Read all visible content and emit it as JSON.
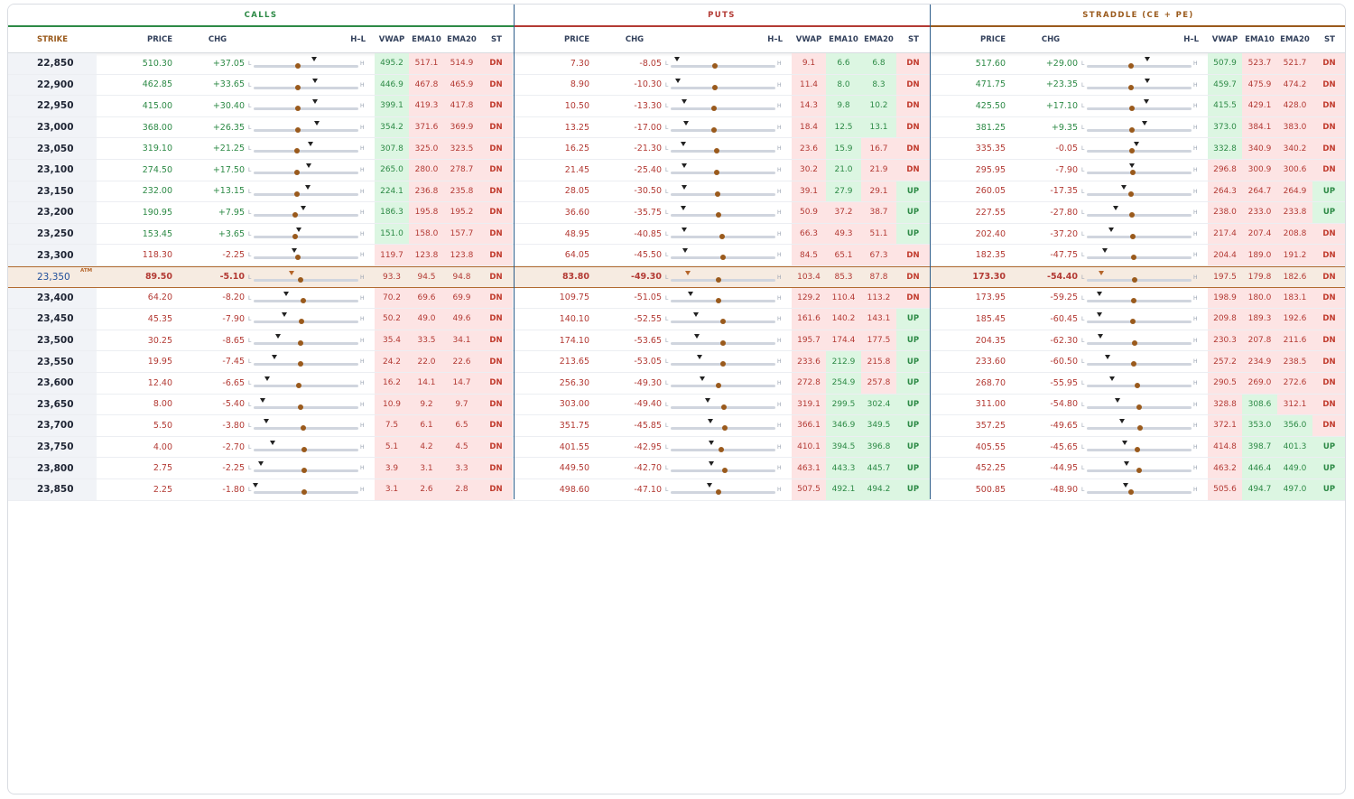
{
  "headers": {
    "calls": "CALLS",
    "puts": "PUTS",
    "straddle": "STRADDLE (CE + PE)",
    "strike": "STRIKE",
    "price": "PRICE",
    "chg": "CHG",
    "hl": "H–L",
    "vwap": "VWAP",
    "ema10": "EMA10",
    "ema20": "EMA20",
    "st": "ST",
    "low_label": "L",
    "high_label": "H",
    "atm_tag": "ATM"
  },
  "colors": {
    "calls": "#2d8a46",
    "puts": "#b33a34",
    "straddle": "#9a5a1c",
    "red_text": "#b33a34",
    "green_text": "#2d8a46",
    "red_bg": "#fde4e4",
    "green_bg": "#dcf6e2",
    "atm_bg": "#f6ebe1"
  },
  "icons": {
    "range_marker": "triangle-down-icon",
    "ltp_dot": "dot-icon"
  },
  "atm_strike": "23,350",
  "rows": [
    {
      "strike": "22,850",
      "c": [
        "510.30",
        "+37.05",
        0.58,
        0.42,
        "495.2",
        "517.1",
        "514.9",
        "DN"
      ],
      "p": [
        "7.30",
        "-8.05",
        0.06,
        0.42,
        "9.1",
        "6.6",
        "6.8",
        "DN"
      ],
      "s": [
        "517.60",
        "+29.00",
        0.58,
        0.42,
        "507.9",
        "523.7",
        "521.7",
        "DN"
      ]
    },
    {
      "strike": "22,900",
      "c": [
        "462.85",
        "+33.65",
        0.59,
        0.42,
        "446.9",
        "467.8",
        "465.9",
        "DN"
      ],
      "p": [
        "8.90",
        "-10.30",
        0.07,
        0.42,
        "11.4",
        "8.0",
        "8.3",
        "DN"
      ],
      "s": [
        "471.75",
        "+23.35",
        0.58,
        0.42,
        "459.7",
        "475.9",
        "474.2",
        "DN"
      ]
    },
    {
      "strike": "22,950",
      "c": [
        "415.00",
        "+30.40",
        0.59,
        0.42,
        "399.1",
        "419.3",
        "417.8",
        "DN"
      ],
      "p": [
        "10.50",
        "-13.30",
        0.13,
        0.41,
        "14.3",
        "9.8",
        "10.2",
        "DN"
      ],
      "s": [
        "425.50",
        "+17.10",
        0.57,
        0.43,
        "415.5",
        "429.1",
        "428.0",
        "DN"
      ]
    },
    {
      "strike": "23,000",
      "c": [
        "368.00",
        "+26.35",
        0.6,
        0.42,
        "354.2",
        "371.6",
        "369.9",
        "DN"
      ],
      "p": [
        "13.25",
        "-17.00",
        0.15,
        0.41,
        "18.4",
        "12.5",
        "13.1",
        "DN"
      ],
      "s": [
        "381.25",
        "+9.35",
        0.55,
        0.43,
        "373.0",
        "384.1",
        "383.0",
        "DN"
      ]
    },
    {
      "strike": "23,050",
      "c": [
        "319.10",
        "+21.25",
        0.54,
        0.41,
        "307.8",
        "325.0",
        "323.5",
        "DN"
      ],
      "p": [
        "16.25",
        "-21.30",
        0.12,
        0.44,
        "23.6",
        "15.9",
        "16.7",
        "DN"
      ],
      "s": [
        "335.35",
        "-0.05",
        0.47,
        0.43,
        "332.8",
        "340.9",
        "340.2",
        "DN"
      ]
    },
    {
      "strike": "23,100",
      "c": [
        "274.50",
        "+17.50",
        0.53,
        0.41,
        "265.0",
        "280.0",
        "278.7",
        "DN"
      ],
      "p": [
        "21.45",
        "-25.40",
        0.13,
        0.44,
        "30.2",
        "21.0",
        "21.9",
        "DN"
      ],
      "s": [
        "295.95",
        "-7.90",
        0.43,
        0.44,
        "296.8",
        "300.9",
        "300.6",
        "DN"
      ]
    },
    {
      "strike": "23,150",
      "c": [
        "232.00",
        "+13.15",
        0.52,
        0.41,
        "224.1",
        "236.8",
        "235.8",
        "DN"
      ],
      "p": [
        "28.05",
        "-30.50",
        0.13,
        0.45,
        "39.1",
        "27.9",
        "29.1",
        "UP"
      ],
      "s": [
        "260.05",
        "-17.35",
        0.35,
        0.42,
        "264.3",
        "264.7",
        "264.9",
        "UP"
      ]
    },
    {
      "strike": "23,200",
      "c": [
        "190.95",
        "+7.95",
        0.47,
        0.4,
        "186.3",
        "195.8",
        "195.2",
        "DN"
      ],
      "p": [
        "36.60",
        "-35.75",
        0.12,
        0.46,
        "50.9",
        "37.2",
        "38.7",
        "UP"
      ],
      "s": [
        "227.55",
        "-27.80",
        0.28,
        0.43,
        "238.0",
        "233.0",
        "233.8",
        "UP"
      ]
    },
    {
      "strike": "23,250",
      "c": [
        "153.45",
        "+3.65",
        0.43,
        0.4,
        "151.0",
        "158.0",
        "157.7",
        "DN"
      ],
      "p": [
        "48.95",
        "-40.85",
        0.13,
        0.49,
        "66.3",
        "49.3",
        "51.1",
        "UP"
      ],
      "s": [
        "202.40",
        "-37.20",
        0.23,
        0.44,
        "217.4",
        "207.4",
        "208.8",
        "DN"
      ]
    },
    {
      "strike": "23,300",
      "c": [
        "118.30",
        "-2.25",
        0.39,
        0.42,
        "119.7",
        "123.8",
        "123.8",
        "DN"
      ],
      "p": [
        "64.05",
        "-45.50",
        0.14,
        0.5,
        "84.5",
        "65.1",
        "67.3",
        "DN"
      ],
      "s": [
        "182.35",
        "-47.75",
        0.17,
        0.45,
        "204.4",
        "189.0",
        "191.2",
        "DN"
      ]
    },
    {
      "strike": "23,350",
      "c": [
        "89.50",
        "-5.10",
        0.36,
        0.45,
        "93.3",
        "94.5",
        "94.8",
        "DN"
      ],
      "p": [
        "83.80",
        "-49.30",
        0.16,
        0.46,
        "103.4",
        "85.3",
        "87.8",
        "DN"
      ],
      "s": [
        "173.30",
        "-54.40",
        0.14,
        0.46,
        "197.5",
        "179.8",
        "182.6",
        "DN"
      ]
    },
    {
      "strike": "23,400",
      "c": [
        "64.20",
        "-8.20",
        0.31,
        0.47,
        "70.2",
        "69.6",
        "69.9",
        "DN"
      ],
      "p": [
        "109.75",
        "-51.05",
        0.19,
        0.46,
        "129.2",
        "110.4",
        "113.2",
        "DN"
      ],
      "s": [
        "173.95",
        "-59.25",
        0.12,
        0.45,
        "198.9",
        "180.0",
        "183.1",
        "DN"
      ]
    },
    {
      "strike": "23,450",
      "c": [
        "45.35",
        "-7.90",
        0.29,
        0.46,
        "50.2",
        "49.0",
        "49.6",
        "DN"
      ],
      "p": [
        "140.10",
        "-52.55",
        0.24,
        0.5,
        "161.6",
        "140.2",
        "143.1",
        "UP"
      ],
      "s": [
        "185.45",
        "-60.45",
        0.12,
        0.44,
        "209.8",
        "189.3",
        "192.6",
        "DN"
      ]
    },
    {
      "strike": "23,500",
      "c": [
        "30.25",
        "-8.65",
        0.23,
        0.45,
        "35.4",
        "33.5",
        "34.1",
        "DN"
      ],
      "p": [
        "174.10",
        "-53.65",
        0.25,
        0.5,
        "195.7",
        "174.4",
        "177.5",
        "UP"
      ],
      "s": [
        "204.35",
        "-62.30",
        0.13,
        0.46,
        "230.3",
        "207.8",
        "211.6",
        "DN"
      ]
    },
    {
      "strike": "23,550",
      "c": [
        "19.95",
        "-7.45",
        0.2,
        0.45,
        "24.2",
        "22.0",
        "22.6",
        "DN"
      ],
      "p": [
        "213.65",
        "-53.05",
        0.28,
        0.5,
        "233.6",
        "212.9",
        "215.8",
        "UP"
      ],
      "s": [
        "233.60",
        "-60.50",
        0.2,
        0.45,
        "257.2",
        "234.9",
        "238.5",
        "DN"
      ]
    },
    {
      "strike": "23,600",
      "c": [
        "12.40",
        "-6.65",
        0.13,
        0.43,
        "16.2",
        "14.1",
        "14.7",
        "DN"
      ],
      "p": [
        "256.30",
        "-49.30",
        0.3,
        0.46,
        "272.8",
        "254.9",
        "257.8",
        "UP"
      ],
      "s": [
        "268.70",
        "-55.95",
        0.24,
        0.48,
        "290.5",
        "269.0",
        "272.6",
        "DN"
      ]
    },
    {
      "strike": "23,650",
      "c": [
        "8.00",
        "-5.40",
        0.09,
        0.45,
        "10.9",
        "9.2",
        "9.7",
        "DN"
      ],
      "p": [
        "303.00",
        "-49.40",
        0.35,
        0.51,
        "319.1",
        "299.5",
        "302.4",
        "UP"
      ],
      "s": [
        "311.00",
        "-54.80",
        0.29,
        0.5,
        "328.8",
        "308.6",
        "312.1",
        "DN"
      ]
    },
    {
      "strike": "23,700",
      "c": [
        "5.50",
        "-3.80",
        0.12,
        0.47,
        "7.5",
        "6.1",
        "6.5",
        "DN"
      ],
      "p": [
        "351.75",
        "-45.85",
        0.38,
        0.52,
        "366.1",
        "346.9",
        "349.5",
        "UP"
      ],
      "s": [
        "357.25",
        "-49.65",
        0.34,
        0.51,
        "372.1",
        "353.0",
        "356.0",
        "DN"
      ]
    },
    {
      "strike": "23,750",
      "c": [
        "4.00",
        "-2.70",
        0.18,
        0.48,
        "5.1",
        "4.2",
        "4.5",
        "DN"
      ],
      "p": [
        "401.55",
        "-42.95",
        0.39,
        0.48,
        "410.1",
        "394.5",
        "396.8",
        "UP"
      ],
      "s": [
        "405.55",
        "-45.65",
        0.36,
        0.48,
        "414.8",
        "398.7",
        "401.3",
        "UP"
      ]
    },
    {
      "strike": "23,800",
      "c": [
        "2.75",
        "-2.25",
        0.07,
        0.48,
        "3.9",
        "3.1",
        "3.3",
        "DN"
      ],
      "p": [
        "449.50",
        "-42.70",
        0.39,
        0.52,
        "463.1",
        "443.3",
        "445.7",
        "UP"
      ],
      "s": [
        "452.25",
        "-44.95",
        0.38,
        0.5,
        "463.2",
        "446.4",
        "449.0",
        "UP"
      ]
    },
    {
      "strike": "23,850",
      "c": [
        "2.25",
        "-1.80",
        0.02,
        0.48,
        "3.1",
        "2.6",
        "2.8",
        "DN"
      ],
      "p": [
        "498.60",
        "-47.10",
        0.37,
        0.46,
        "507.5",
        "492.1",
        "494.2",
        "UP"
      ],
      "s": [
        "500.85",
        "-48.90",
        0.37,
        0.42,
        "505.6",
        "494.7",
        "497.0",
        "UP"
      ]
    }
  ]
}
